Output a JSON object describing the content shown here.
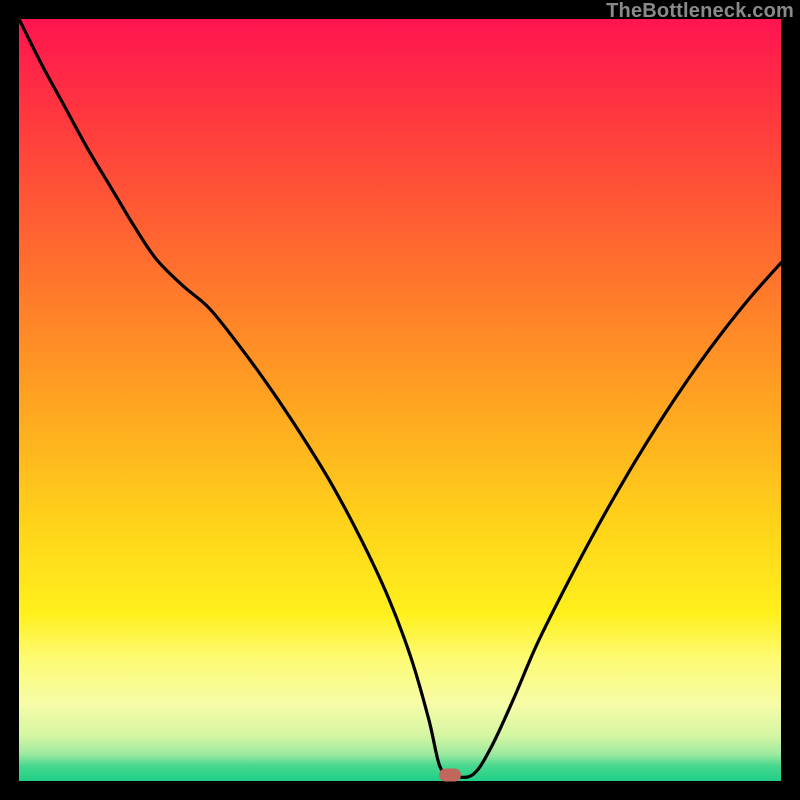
{
  "watermark": {
    "text": "TheBottleneck.com"
  },
  "colors": {
    "black": "#000000",
    "curve": "#000000",
    "marker": "#c0675e",
    "gradient_stops": [
      {
        "pct": 0,
        "color": "#ff1450"
      },
      {
        "pct": 14,
        "color": "#ff3b3d"
      },
      {
        "pct": 32,
        "color": "#ff6e2e"
      },
      {
        "pct": 50,
        "color": "#ffa321"
      },
      {
        "pct": 66,
        "color": "#ffd21a"
      },
      {
        "pct": 78,
        "color": "#fff01c"
      },
      {
        "pct": 84,
        "color": "#fdfb74"
      },
      {
        "pct": 90,
        "color": "#f6fca8"
      },
      {
        "pct": 94,
        "color": "#d5f6a2"
      },
      {
        "pct": 96.5,
        "color": "#9de9a0"
      },
      {
        "pct": 98,
        "color": "#48d88f"
      },
      {
        "pct": 100,
        "color": "#1fce86"
      }
    ]
  },
  "chart_data": {
    "type": "line",
    "title": "",
    "xlabel": "",
    "ylabel": "",
    "xlim": [
      0,
      100
    ],
    "ylim": [
      0,
      100
    ],
    "optimum_x": 56.6,
    "series": [
      {
        "name": "bottleneck-curve",
        "x": [
          0.0,
          3.0,
          6.0,
          9.0,
          12.0,
          15.0,
          18.0,
          21.5,
          25.0,
          29.0,
          33.0,
          37.0,
          41.0,
          45.0,
          48.5,
          51.5,
          53.8,
          55.2,
          56.6,
          59.5,
          62.0,
          65.0,
          68.0,
          72.0,
          76.0,
          80.0,
          84.0,
          88.0,
          92.0,
          96.0,
          100.0
        ],
        "y": [
          100.0,
          94.0,
          88.5,
          83.0,
          78.0,
          73.0,
          68.5,
          65.0,
          62.0,
          57.0,
          51.5,
          45.5,
          39.0,
          31.5,
          24.0,
          16.0,
          8.0,
          2.0,
          0.8,
          0.8,
          4.5,
          11.0,
          18.0,
          26.0,
          33.5,
          40.5,
          47.0,
          53.0,
          58.5,
          63.5,
          68.0
        ]
      }
    ],
    "marker": {
      "x": 56.6,
      "y": 0.8
    }
  }
}
